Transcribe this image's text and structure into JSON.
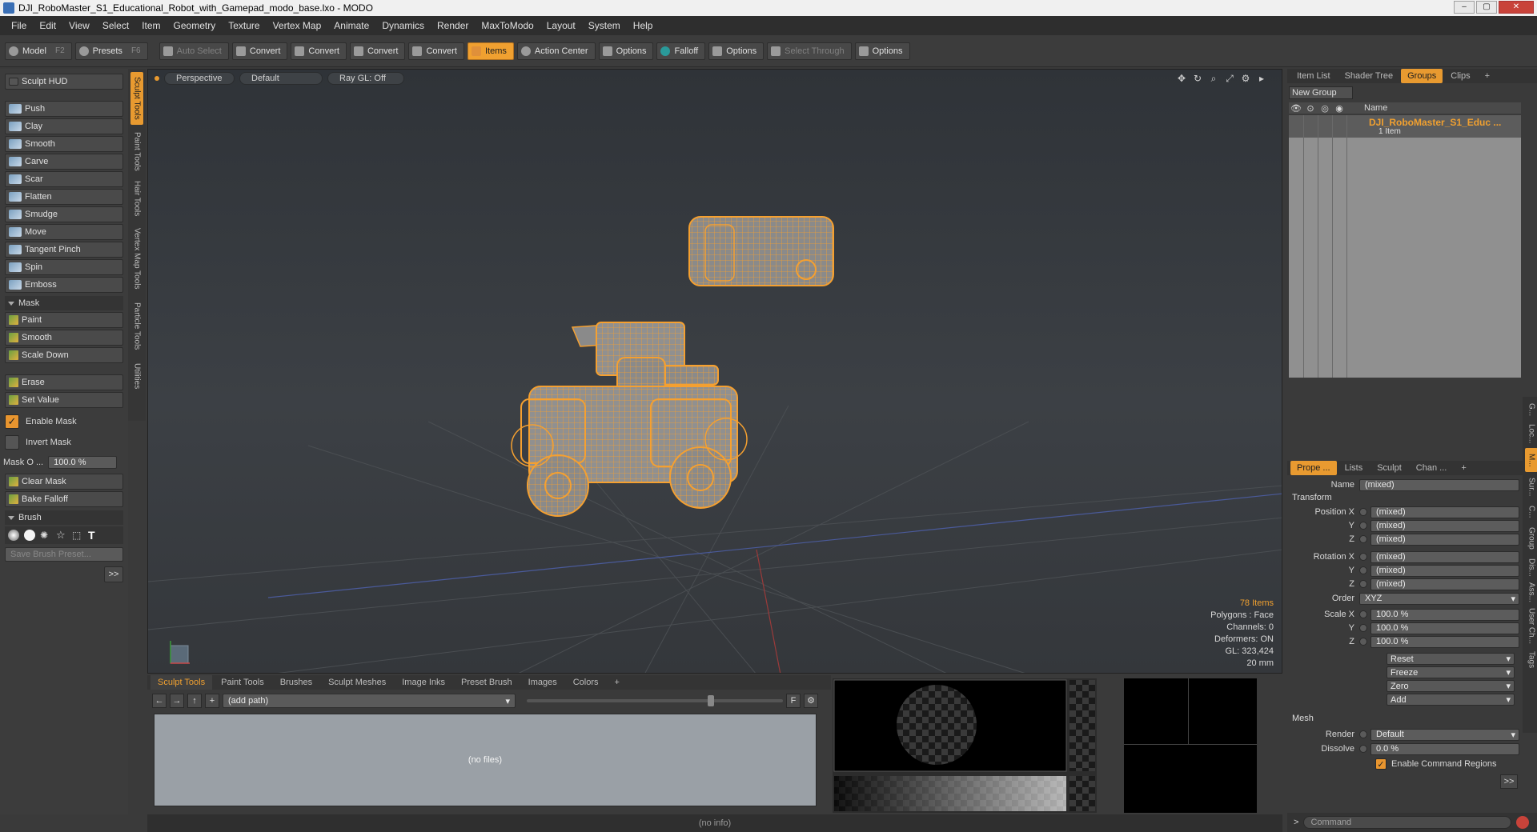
{
  "window": {
    "title": "DJI_RoboMaster_S1_Educational_Robot_with_Gamepad_modo_base.lxo - MODO"
  },
  "menu": [
    "File",
    "Edit",
    "View",
    "Select",
    "Item",
    "Geometry",
    "Texture",
    "Vertex Map",
    "Animate",
    "Dynamics",
    "Render",
    "MaxToModo",
    "Layout",
    "System",
    "Help"
  ],
  "toolbar": {
    "model": "Model",
    "model_key": "F2",
    "presets": "Presets",
    "presets_key": "F6",
    "auto_select": "Auto Select",
    "convert1": "Convert",
    "convert2": "Convert",
    "convert3": "Convert",
    "convert4": "Convert",
    "items": "Items",
    "action_center": "Action Center",
    "options1": "Options",
    "falloff": "Falloff",
    "options2": "Options",
    "select_through": "Select Through",
    "options3": "Options"
  },
  "sculpt": {
    "hud": "Sculpt HUD",
    "tools": [
      "Push",
      "Clay",
      "Smooth",
      "Carve",
      "Scar",
      "Flatten",
      "Smudge",
      "Move",
      "Tangent Pinch",
      "Spin",
      "Emboss"
    ],
    "mask_header": "Mask",
    "mask_tools": [
      "Paint",
      "Smooth",
      "Scale Down"
    ],
    "erase": "Erase",
    "set_value": "Set Value",
    "enable_mask": "Enable Mask",
    "invert_mask": "Invert Mask",
    "mask_opacity_label": "Mask O ...",
    "mask_opacity_value": "100.0 %",
    "clear_mask": "Clear Mask",
    "bake_falloff": "Bake Falloff",
    "brush_header": "Brush",
    "save_brush_preset": "Save Brush Preset...",
    "expand": ">>"
  },
  "side_tabs": [
    "Sculpt Tools",
    "Paint Tools",
    "Hair Tools",
    "Vertex Map Tools",
    "Particle Tools",
    "Utilities"
  ],
  "viewport": {
    "tabs": [
      "Perspective",
      "Default",
      "Ray GL: Off"
    ],
    "stats": {
      "items": "78 Items",
      "polygons": "Polygons : Face",
      "channels": "Channels: 0",
      "deformers": "Deformers: ON",
      "gl": "GL: 323,424",
      "scale": "20 mm"
    }
  },
  "browser": {
    "tabs": [
      "Sculpt Tools",
      "Paint Tools",
      "Brushes",
      "Sculpt Meshes",
      "Image Inks",
      "Preset Brush",
      "Images",
      "Colors",
      "+"
    ],
    "path_placeholder": "(add path)",
    "empty": "(no files)",
    "filter_key": "F"
  },
  "status": {
    "info": "(no info)"
  },
  "items_panel": {
    "tabs": [
      "Item List",
      "Shader Tree",
      "Groups",
      "Clips",
      "+"
    ],
    "new_group": "New Group",
    "name_col": "Name",
    "group_name": "DJI_RoboMaster_S1_Educ ...",
    "group_count": "1 Item"
  },
  "props_panel": {
    "tabs": [
      "Prope ...",
      "Lists",
      "Sculpt",
      "Chan ...",
      "+"
    ],
    "name_label": "Name",
    "name_value": "(mixed)",
    "transform_header": "Transform",
    "position_label": "Position X",
    "rotation_label": "Rotation X",
    "scale_label": "Scale X",
    "y_label": "Y",
    "z_label": "Z",
    "mixed": "(mixed)",
    "order_label": "Order",
    "order_value": "XYZ",
    "scale_value": "100.0 %",
    "reset": "Reset",
    "freeze": "Freeze",
    "zero": "Zero",
    "add": "Add",
    "mesh_header": "Mesh",
    "render_label": "Render",
    "render_value": "Default",
    "dissolve_label": "Dissolve",
    "dissolve_value": "0.0 %",
    "enable_cmd_regions": "Enable Command Regions",
    "expand": ">>"
  },
  "right_vtabs": [
    "G...",
    "Loc...",
    "M...",
    "Sur...",
    "C...",
    "Group",
    "Dis...",
    "Ass...",
    "User Ch...",
    "Tags"
  ],
  "command": {
    "placeholder": "Command"
  },
  "colors": {
    "accent": "#f0a030",
    "wire": "#f5a030"
  }
}
